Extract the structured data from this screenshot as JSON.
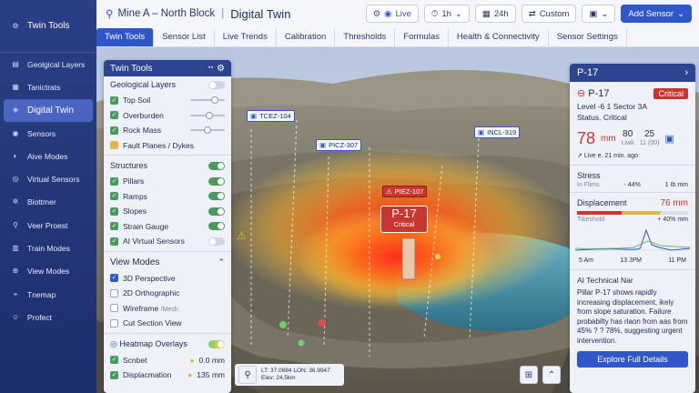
{
  "app": {
    "site": "Mine A – North Block",
    "page_title": "Digital Twin"
  },
  "toolbar": {
    "live": "Live",
    "range": "1h",
    "range_alt": "24h",
    "custom": "Custom",
    "add_sensor": "Add Sensor"
  },
  "sidebar": {
    "header": "Twin Tools",
    "items": [
      {
        "label": "Geolgical Layers",
        "icon": "layers-icon"
      },
      {
        "label": "Tanictrats",
        "icon": "document-icon"
      },
      {
        "label": "Digital Twin",
        "icon": "twin-icon",
        "active": true
      },
      {
        "label": "Sensors",
        "icon": "sensor-icon"
      },
      {
        "label": "Aive Modes",
        "icon": "mode-icon"
      },
      {
        "label": "Virtual Sensors",
        "icon": "virtual-sensor-icon"
      },
      {
        "label": "Biottmer",
        "icon": "gear-icon"
      },
      {
        "label": "Veer Proest",
        "icon": "chart-icon"
      },
      {
        "label": "Train Modes",
        "icon": "train-icon"
      },
      {
        "label": "View Modes",
        "icon": "globe-icon"
      },
      {
        "label": "Tnemap",
        "icon": "map-icon"
      },
      {
        "label": "Profect",
        "icon": "user-icon"
      }
    ]
  },
  "tabs": [
    "Twin Tools",
    "Sensor List",
    "Live Trends",
    "Calibration",
    "Thresholds",
    "Formulas",
    "Health & Connectivity",
    "Sensor Settings"
  ],
  "panel": {
    "title": "Twin Tools",
    "geo_header": "Geological Layers",
    "geo_layers": [
      {
        "label": "Top Soil",
        "level": 0.6
      },
      {
        "label": "Overburden",
        "level": 0.55
      },
      {
        "label": "Rock Mass",
        "level": 0.5
      },
      {
        "label": "Fault Planes / Dykes",
        "level": null
      }
    ],
    "structures_header": "Structures",
    "structures": [
      {
        "label": "Pillars",
        "on": true
      },
      {
        "label": "Ramps",
        "on": true
      },
      {
        "label": "Slopes",
        "on": true
      },
      {
        "label": "Strain Gauge",
        "on": true
      },
      {
        "label": "AI Virtual Sensors",
        "on": false
      }
    ],
    "view_header": "View Modes",
    "view_modes": [
      {
        "label": "3D Perspective",
        "checked": true,
        "sub": ""
      },
      {
        "label": "2D Orthographic",
        "checked": false,
        "sub": ""
      },
      {
        "label": "Wireframe",
        "checked": false,
        "sub": "/Mesh"
      },
      {
        "label": "Cut Section View",
        "checked": false,
        "sub": ""
      }
    ],
    "heatmap_header": "Heatmap Overlays",
    "heatmaps": [
      {
        "label": "Scnbet",
        "value": "0.0 mm"
      },
      {
        "label": "Displacmation",
        "value": "135 mm"
      }
    ]
  },
  "scene": {
    "labels": [
      "TCEZ-104",
      "PICZ-307",
      "INCL-319",
      "PIEZ-107"
    ],
    "marker_id": "P-17",
    "marker_status": "Critical",
    "coord_lat": "LT: 37.0884",
    "coord_lon": "LON: 36.9947",
    "coord_elev": "Elev: 24.5km"
  },
  "detail": {
    "header_id": "P-17",
    "id": "P-17",
    "status": "Critical",
    "location": "Level -6 1 Sector 3A",
    "status_line": "Status. Critical",
    "value": "78",
    "unit": "mm",
    "stat1": "80",
    "stat1_sub": "Liwk",
    "stat2": "25",
    "stat2_sub": "11 (00)",
    "live_text": "Live e. 21 min. ago",
    "stress_label": "Stress",
    "stress_sub": "In Flims",
    "stress_pct": "- 44%",
    "stress_value": "1 Ib mm",
    "displacement_label": "Displacement",
    "displacement_value": "76 mm",
    "threshold_label": "Tibeshold",
    "threshold_pct": "+ 40% mm",
    "times": [
      "5 Am",
      "13 JPM",
      "11 PM"
    ],
    "ai_header": "AI Technical Nar",
    "ai_text": "Pillar P-17 shows rapidly increasing displacement, ikely from slope saturation. Failure probabilty has rlaon from aas from 45% ? ? 78%, suggesting urgent intervention.",
    "explore": "Explore Full Details"
  },
  "colors": {
    "accent": "#2f57c9",
    "critical": "#c9362f",
    "sidebar": "#253a7e"
  }
}
